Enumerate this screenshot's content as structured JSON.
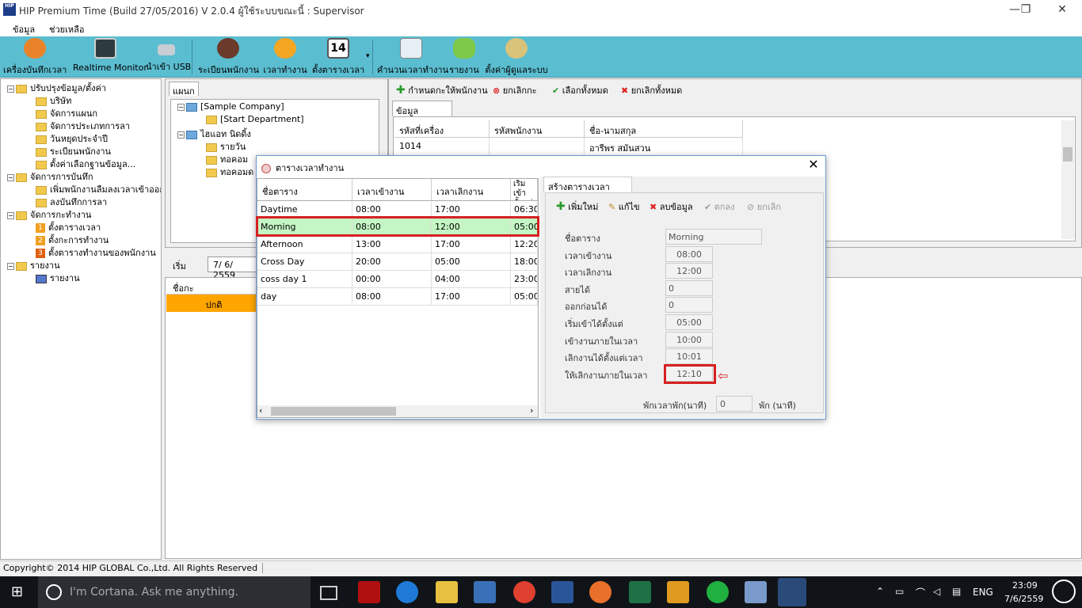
{
  "window": {
    "title": "HIP Premium Time (Build 27/05/2016) V 2.0.4   ผู้ใช้ระบบขณะนี้ : Supervisor",
    "minimize": "—",
    "maximize": "❐",
    "close": "✕"
  },
  "menu": [
    "ข้อมูล",
    "ช่วยเหลือ"
  ],
  "toolbar": [
    "เครื่องบันทึกเวลา",
    "Realtime Monitor",
    "นำเข้า USB",
    "ระเบียนพนักงาน",
    "เวลาทำงาน",
    "ตั้งตารางเวลา",
    "คำนวนเวลาทำงาน",
    "รายงาน",
    "ตั้งค่าผู้ดูแลระบบ"
  ],
  "toolbar_dropdown": "▾",
  "tree": {
    "setup": "ปรับปรุงข้อมูล/ตั้งค่า",
    "company": "บริษัท",
    "department": "จัดการแผนก",
    "leave_type": "จัดการประเภทการลา",
    "holiday": "วันหยุดประจำปี",
    "employee_reg": "ระเบียนพนักงาน",
    "base_setting": "ตั้งค่าเลือกฐานข้อมูล...",
    "records": "จัดการการบันทึก",
    "add_forgot": "เพิ่มพนักงานลืมลงเวลาเข้าออก",
    "leave_record": "ลงบันทึกการลา",
    "workdays": "จัดการกะทำงาน",
    "set_time": "ตั้งตารางเวลา",
    "set_shift": "ตั้งกะการทำงาน",
    "set_emp_shift": "ตั้งตารางทำงานของพนักงาน",
    "reports": "รายงาน",
    "report": "รายงาน",
    "n1": "1",
    "n2": "2",
    "n3": "3"
  },
  "dept": {
    "tab": "แผนก",
    "company": "[Sample Company]",
    "start_dept": "[Start Department]",
    "branch": "ไฮแอท นิดดิ้ง",
    "d1": "รายวัน",
    "d2": "ทอคอม",
    "d3": "ทอคอมด"
  },
  "right_toolbar": {
    "assign": "กำหนดกะให้พนักงาน",
    "cancel_shift": "ยกเลิกกะ",
    "select_all": "เลือกทั้งหมด",
    "unselect_all": "ยกเลิกทั้งหมด"
  },
  "employee": {
    "tab": "ข้อมูลพนักงาน",
    "headers": [
      "รหัสที่เครื่อง",
      "รหัสพนักงาน",
      "ชื่อ-นามสกุล"
    ],
    "row": [
      "1014",
      "",
      "อารีพร  สมันสวน"
    ]
  },
  "date": {
    "label": "เริ่ม",
    "value": "7/  6/  2559"
  },
  "shift": {
    "header": "ชื่อกะ",
    "row": "ปกติ"
  },
  "status": "Copyright© 2014 HIP GLOBAL Co.,Ltd. All Rights Reserved",
  "dialog": {
    "title": "ตารางเวลาทำงาน",
    "close": "✕",
    "headers": [
      "ชื่อตาราง",
      "เวลาเข้างาน",
      "เวลาเลิกงาน",
      "เริ่มเข้าตั้งแต่"
    ],
    "rows": [
      [
        "Daytime",
        "08:00",
        "17:00",
        "06:30"
      ],
      [
        "Morning",
        "08:00",
        "12:00",
        "05:00"
      ],
      [
        "Afternoon",
        "13:00",
        "17:00",
        "12:20"
      ],
      [
        "Cross Day",
        "20:00",
        "05:00",
        "18:00"
      ],
      [
        "coss day 1",
        "00:00",
        "04:00",
        "23:00"
      ],
      [
        "day",
        "08:00",
        "17:00",
        "05:00"
      ]
    ],
    "scroll_left": "‹",
    "scroll_right": "›",
    "form": {
      "tab": "สร้างตารางเวลาทำงาน",
      "add": "เพิ่มใหม่",
      "edit": "แก้ไข",
      "delete": "ลบข้อมูล",
      "ok": "ตกลง",
      "cancel": "ยกเลิก",
      "fields": [
        {
          "label": "ชื่อตาราง",
          "value": "Morning"
        },
        {
          "label": "เวลาเข้างาน",
          "value": "08:00"
        },
        {
          "label": "เวลาเลิกงาน",
          "value": "12:00"
        },
        {
          "label": "สายได้",
          "value": "0"
        },
        {
          "label": "ออกก่อนได้",
          "value": "0"
        },
        {
          "label": "เริ่มเข้าได้ตั้งแต่",
          "value": "05:00"
        },
        {
          "label": "เข้างานภายในเวลา",
          "value": "10:00"
        },
        {
          "label": "เลิกงานได้ตั้งแต่เวลา",
          "value": "10:01"
        },
        {
          "label": "ให้เลิกงานภายในเวลา",
          "value": "12:10"
        }
      ],
      "break_label": "พักเวลาพัก(นาที)",
      "break_value": "0",
      "break_unit": "พัก (นาที)"
    }
  },
  "taskbar": {
    "cortana": "I'm Cortana. Ask me anything.",
    "lang": "ENG",
    "time": "23:09",
    "date": "7/6/2559"
  },
  "colors": {
    "toolbar": "#5bbdd0",
    "selected_row": "#c4f5c4",
    "highlight_border": "#d62020",
    "orange": "#ffa500"
  }
}
